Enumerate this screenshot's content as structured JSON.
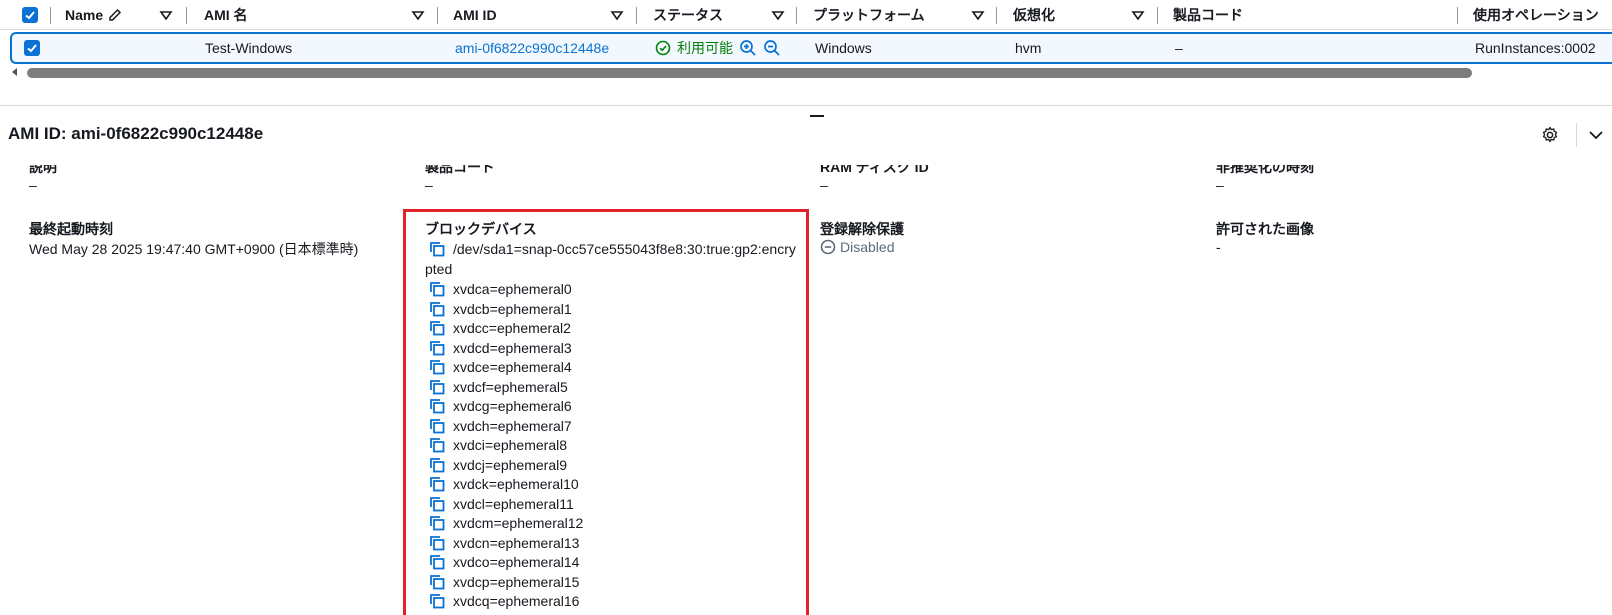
{
  "table": {
    "columns": [
      {
        "label": "Name",
        "icon": "pencil-icon"
      },
      {
        "label": "AMI 名"
      },
      {
        "label": "AMI ID"
      },
      {
        "label": "ステータス"
      },
      {
        "label": "プラットフォーム"
      },
      {
        "label": "仮想化"
      },
      {
        "label": "製品コード"
      },
      {
        "label": "使用オペレーション"
      }
    ],
    "row": {
      "name": "",
      "ami_name": "Test-Windows",
      "ami_id": "ami-0f6822c990c12448e",
      "status": "利用可能",
      "platform": "Windows",
      "virtualization": "hvm",
      "product_code": "–",
      "usage_operation": "RunInstances:0002"
    }
  },
  "details": {
    "title": "AMI ID: ami-0f6822c990c12448e",
    "top_row": [
      {
        "label": "説明",
        "value": "–"
      },
      {
        "label": "製品コード",
        "value": "–"
      },
      {
        "label": "RAM ディスク ID",
        "value": "–"
      },
      {
        "label": "非推奨化の時刻",
        "value": "–"
      }
    ],
    "last_launched": {
      "label": "最終起動時刻",
      "value": "Wed May 28 2025 19:47:40 GMT+0900 (日本標準時)"
    },
    "block_devices": {
      "label": "ブロックデバイス",
      "items": [
        "/dev/sda1=snap-0cc57ce555043f8e8:30:true:gp2:encrypted",
        "xvdca=ephemeral0",
        "xvdcb=ephemeral1",
        "xvdcc=ephemeral2",
        "xvdcd=ephemeral3",
        "xvdce=ephemeral4",
        "xvdcf=ephemeral5",
        "xvdcg=ephemeral6",
        "xvdch=ephemeral7",
        "xvdci=ephemeral8",
        "xvdcj=ephemeral9",
        "xvdck=ephemeral10",
        "xvdcl=ephemeral11",
        "xvdcm=ephemeral12",
        "xvdcn=ephemeral13",
        "xvdco=ephemeral14",
        "xvdcp=ephemeral15",
        "xvdcq=ephemeral16"
      ]
    },
    "deregistration_protection": {
      "label": "登録解除保護",
      "value": "Disabled"
    },
    "allowed_image": {
      "label": "許可された画像",
      "value": "-"
    }
  },
  "colors": {
    "accent": "#0972d3",
    "success": "#037f0c",
    "highlight": "#e2222a"
  }
}
